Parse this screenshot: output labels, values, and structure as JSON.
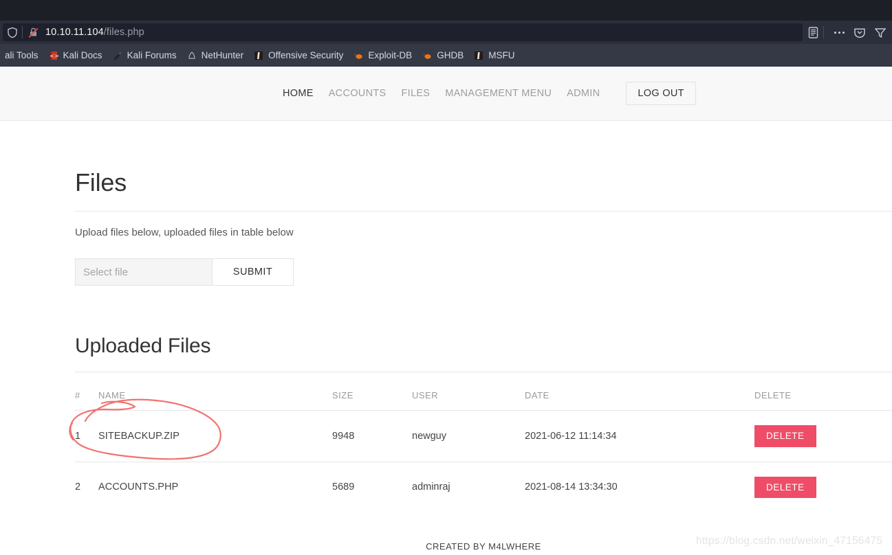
{
  "browser": {
    "url_host": "10.10.11.104",
    "url_path": "/files.php",
    "shield_icon": "shield-icon",
    "not_secure_icon": "crossed-out-lock-icon",
    "reader_icon": "reader-view-icon",
    "menu_icon": "more-options-icon",
    "pocket_icon": "pocket-save-icon",
    "bookmarks": [
      {
        "label": "ali Tools",
        "icon": "kali-tools-icon"
      },
      {
        "label": "Kali Docs",
        "icon": "kali-docs-book-icon"
      },
      {
        "label": "Kali Forums",
        "icon": "kali-forums-icon"
      },
      {
        "label": "NetHunter",
        "icon": "nethunter-icon"
      },
      {
        "label": "Offensive Security",
        "icon": "offensive-security-icon"
      },
      {
        "label": "Exploit-DB",
        "icon": "exploit-db-icon"
      },
      {
        "label": "GHDB",
        "icon": "ghdb-icon"
      },
      {
        "label": "MSFU",
        "icon": "msfu-icon"
      }
    ]
  },
  "nav": {
    "links": [
      {
        "label": "HOME",
        "active": true
      },
      {
        "label": "ACCOUNTS",
        "active": false
      },
      {
        "label": "FILES",
        "active": false
      },
      {
        "label": "MANAGEMENT MENU",
        "active": false
      },
      {
        "label": "ADMIN",
        "active": false
      }
    ],
    "logout_label": "LOG OUT"
  },
  "files_section": {
    "title": "Files",
    "lead": "Upload files below, uploaded files in table below",
    "file_input_placeholder": "Select file",
    "file_input_value": "",
    "submit_label": "SUBMIT"
  },
  "uploaded_section": {
    "title": "Uploaded Files",
    "columns": [
      "#",
      "NAME",
      "SIZE",
      "USER",
      "DATE",
      "DELETE"
    ],
    "rows": [
      {
        "num": "1",
        "name": "SITEBACKUP.ZIP",
        "size": "9948",
        "user": "newguy",
        "date": "2021-06-12 11:14:34",
        "delete_label": "DELETE"
      },
      {
        "num": "2",
        "name": "ACCOUNTS.PHP",
        "size": "5689",
        "user": "adminraj",
        "date": "2021-08-14 13:34:30",
        "delete_label": "DELETE"
      }
    ]
  },
  "footer": {
    "text": "CREATED BY M4LWHERE"
  },
  "watermark": {
    "text": "https://blog.csdn.net/weixin_47156475"
  },
  "colors": {
    "delete_button": "#ef4c67",
    "navbar_bg": "#f8f8f8",
    "annotation_red": "#f0736f",
    "chrome_dark": "#2b2e3b"
  }
}
